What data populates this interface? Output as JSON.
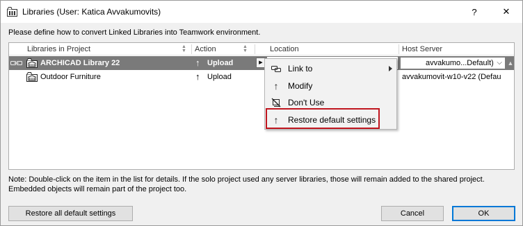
{
  "window": {
    "title": "Libraries (User: Katica Avvakumovits)",
    "help_label": "?",
    "close_label": "✕"
  },
  "instruction": "Please define how to convert Linked Libraries into Teamwork environment.",
  "table": {
    "columns": {
      "libraries": "Libraries in Project",
      "action": "Action",
      "location": "Location",
      "host_server": "Host Server"
    },
    "rows": [
      {
        "name": "ARCHICAD Library 22",
        "action": "Upload",
        "location": "",
        "host_server": "avvakumo...Default)",
        "selected": true
      },
      {
        "name": "Outdoor Furniture",
        "action": "Upload",
        "location": "",
        "host_server": "avvakumovit-w10-v22 (Defau",
        "selected": false
      }
    ]
  },
  "context_menu": {
    "items": [
      {
        "label": "Link to",
        "icon": "link-icon",
        "submenu": true
      },
      {
        "label": "Modify",
        "icon": "up-arrow-icon",
        "submenu": false
      },
      {
        "label": "Don't Use",
        "icon": "dont-use-icon",
        "submenu": false
      },
      {
        "label": "Restore default settings",
        "icon": "up-arrow-icon",
        "submenu": false,
        "highlighted": true
      }
    ],
    "highlight_color": "#c0151e"
  },
  "note": "Note: Double-click on the item in the list for details. If the solo project used any server libraries, those will remain added to the shared project. Embedded objects will remain part of the project too.",
  "buttons": {
    "restore_all": "Restore all default settings",
    "cancel": "Cancel",
    "ok": "OK"
  },
  "colors": {
    "selected_row": "#7a7a7a",
    "dialog_bg": "#f0f0f0",
    "accent_focus": "#0078d7"
  }
}
